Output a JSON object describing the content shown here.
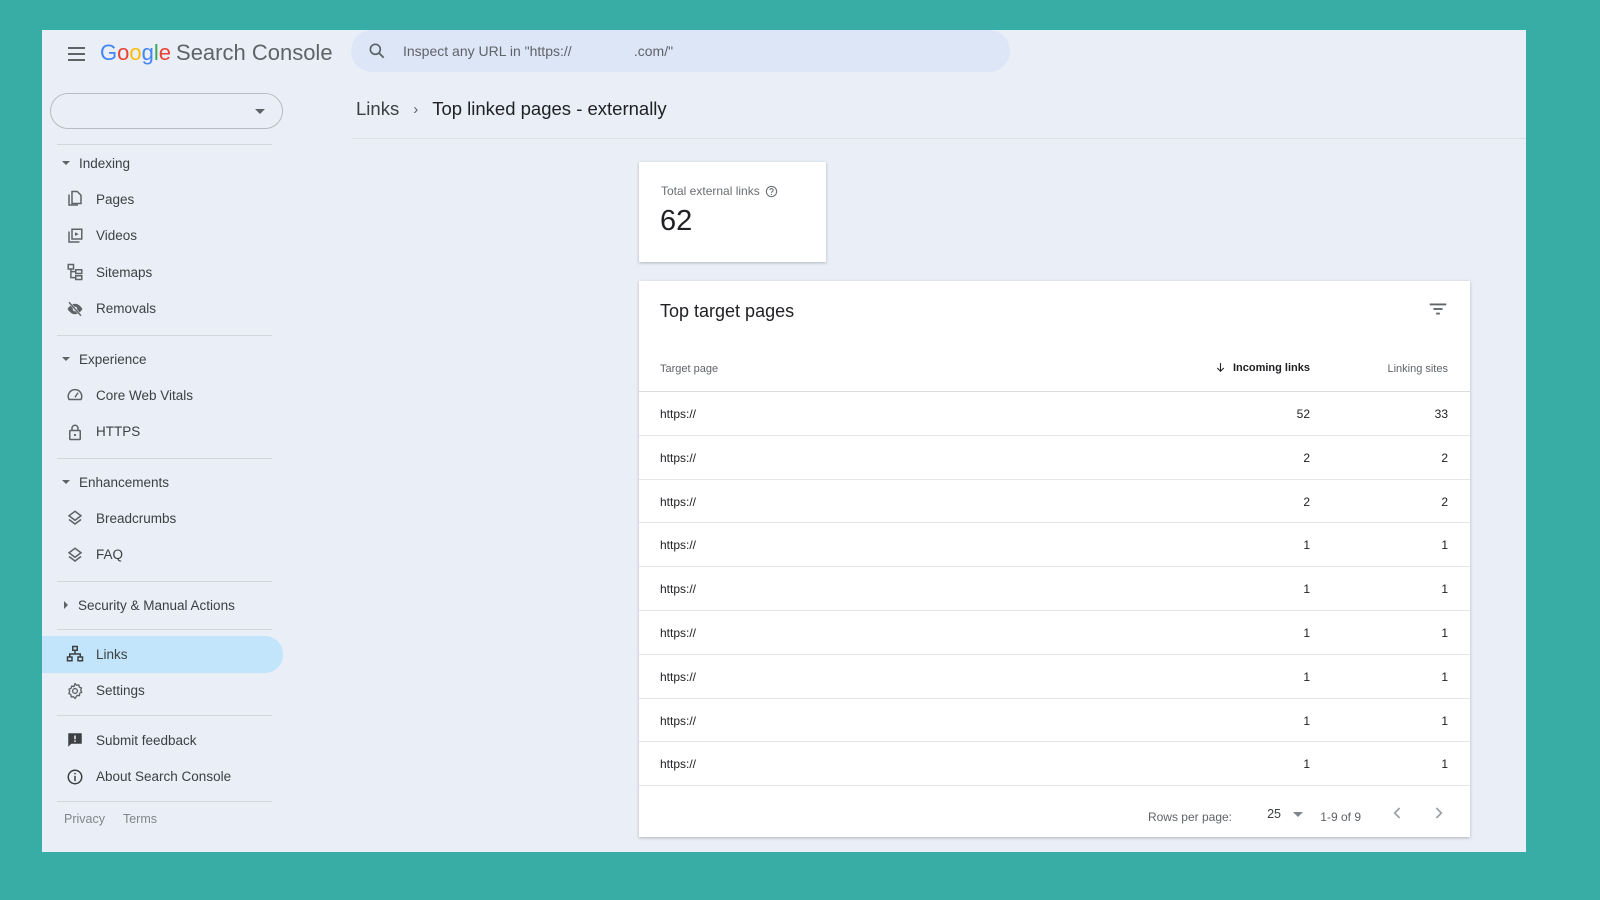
{
  "app": {
    "title_brand": [
      "G",
      "o",
      "o",
      "g",
      "l",
      "e"
    ],
    "title_product": "Search Console",
    "colors": {
      "frame_background": "#38ada6",
      "app_background": "#eaeff7",
      "active_nav": "#c2e5fb",
      "search_background": "#dce6f7"
    }
  },
  "header": {
    "menu_icon": "hamburger-menu-icon",
    "search_placeholder": "Inspect any URL in \"https://                .com/\"",
    "search_icon": "search-icon"
  },
  "property_selector": {
    "value": "",
    "icon": "dropdown-caret-icon"
  },
  "sidebar": {
    "sections": [
      {
        "label": "Indexing",
        "expanded": true,
        "items": [
          {
            "label": "Pages",
            "icon": "pages-icon"
          },
          {
            "label": "Videos",
            "icon": "videos-icon"
          },
          {
            "label": "Sitemaps",
            "icon": "sitemaps-icon"
          },
          {
            "label": "Removals",
            "icon": "removals-icon"
          }
        ]
      },
      {
        "label": "Experience",
        "expanded": true,
        "items": [
          {
            "label": "Core Web Vitals",
            "icon": "speedometer-icon"
          },
          {
            "label": "HTTPS",
            "icon": "lock-icon"
          }
        ]
      },
      {
        "label": "Enhancements",
        "expanded": true,
        "items": [
          {
            "label": "Breadcrumbs",
            "icon": "layers-icon"
          },
          {
            "label": "FAQ",
            "icon": "layers-icon"
          }
        ]
      },
      {
        "label": "Security & Manual Actions",
        "expanded": false,
        "items": []
      }
    ],
    "main_items": [
      {
        "label": "Links",
        "icon": "links-icon",
        "active": true
      },
      {
        "label": "Settings",
        "icon": "gear-icon",
        "active": false
      }
    ],
    "support_items": [
      {
        "label": "Submit feedback",
        "icon": "feedback-icon"
      },
      {
        "label": "About Search Console",
        "icon": "info-icon"
      }
    ],
    "footer_links": [
      "Privacy",
      "Terms"
    ]
  },
  "breadcrumb": {
    "parent": "Links",
    "separator_icon": "chevron-right-icon",
    "current": "Top linked pages - externally"
  },
  "stat_card": {
    "label": "Total external links",
    "help_icon": "help-icon",
    "value": "62"
  },
  "table": {
    "title": "Top target pages",
    "filter_icon": "filter-icon",
    "columns": {
      "target_page": "Target page",
      "incoming_links": "Incoming links",
      "linking_sites": "Linking sites",
      "sort_icon": "arrow-down-icon"
    },
    "rows": [
      {
        "url": "https://",
        "incoming": "52",
        "sites": "33"
      },
      {
        "url": "https://",
        "incoming": "2",
        "sites": "2"
      },
      {
        "url": "https://",
        "incoming": "2",
        "sites": "2"
      },
      {
        "url": "https://",
        "incoming": "1",
        "sites": "1"
      },
      {
        "url": "https://",
        "incoming": "1",
        "sites": "1"
      },
      {
        "url": "https://",
        "incoming": "1",
        "sites": "1"
      },
      {
        "url": "https://",
        "incoming": "1",
        "sites": "1"
      },
      {
        "url": "https://",
        "incoming": "1",
        "sites": "1"
      },
      {
        "url": "https://",
        "incoming": "1",
        "sites": "1"
      }
    ],
    "pagination": {
      "rows_per_page_label": "Rows per page:",
      "rows_per_page_value": "25",
      "range": "1-9 of 9",
      "prev_icon": "chevron-left-icon",
      "next_icon": "chevron-right-icon"
    }
  }
}
